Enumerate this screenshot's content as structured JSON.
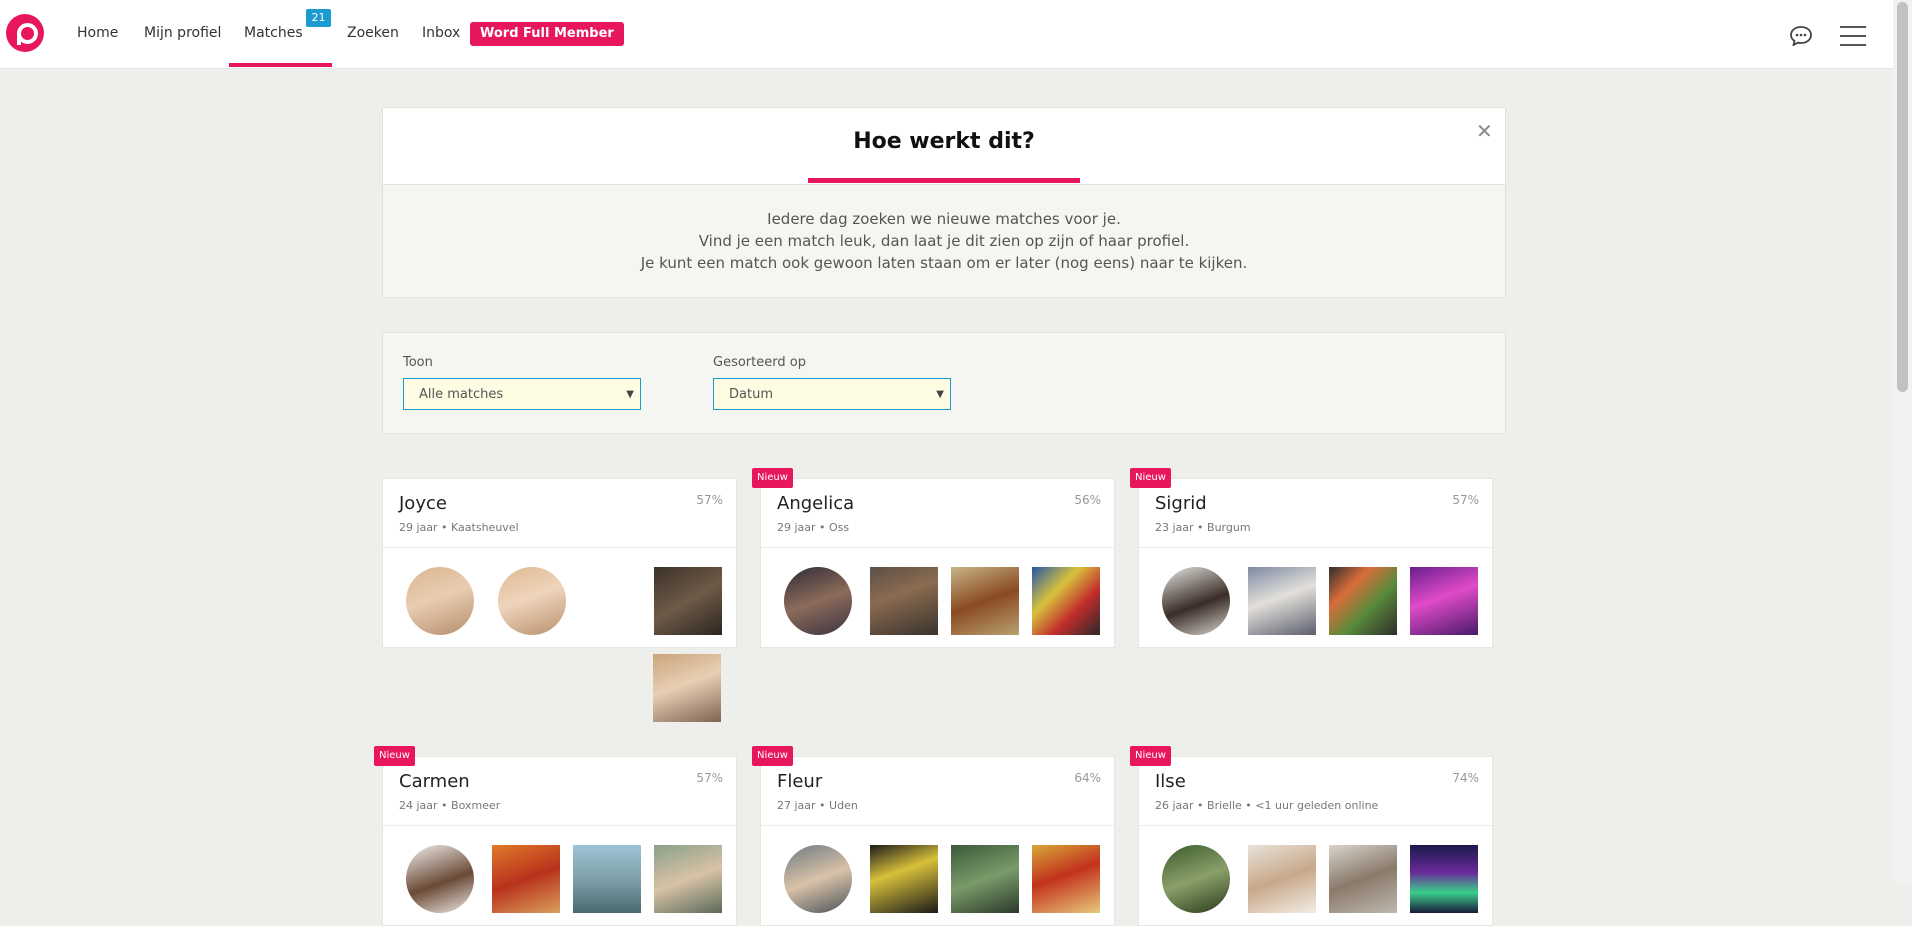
{
  "nav": {
    "items": [
      {
        "label": "Home"
      },
      {
        "label": "Mijn profiel"
      },
      {
        "label": "Matches"
      },
      {
        "label": "Zoeken"
      },
      {
        "label": "Inbox"
      }
    ],
    "matches_badge": "21",
    "cta_label": "Word Full Member",
    "active_item": "Matches"
  },
  "colors": {
    "brand": "#e8175d",
    "badge": "#1b9bd1",
    "select_bg": "#fefde3"
  },
  "icons": {
    "logo": "logo-icon",
    "chat": "chat-icon",
    "menu": "hamburger-icon",
    "close": "close-icon"
  },
  "info": {
    "title": "Hoe werkt dit?",
    "line1": "Iedere dag zoeken we nieuwe matches voor je.",
    "line2": "Vind je een match leuk, dan laat je dit zien op zijn of haar profiel.",
    "line3": "Je kunt een match ook gewoon laten staan om er later (nog eens) naar te kijken."
  },
  "filters": {
    "show_label": "Toon",
    "show_value": "Alle matches",
    "sort_label": "Gesorteerd op",
    "sort_value": "Datum"
  },
  "matches": [
    {
      "name": "Joyce",
      "meta": "29 jaar • Kaatsheuvel",
      "pct": "57%",
      "new": false
    },
    {
      "name": "Angelica",
      "meta": "29 jaar • Oss",
      "pct": "56%",
      "new": true,
      "new_label": "Nieuw"
    },
    {
      "name": "Sigrid",
      "meta": "23 jaar • Burgum",
      "pct": "57%",
      "new": true,
      "new_label": "Nieuw"
    },
    {
      "name": "Carmen",
      "meta": "24 jaar • Boxmeer",
      "pct": "57%",
      "new": true,
      "new_label": "Nieuw"
    },
    {
      "name": "Fleur",
      "meta": "27 jaar • Uden",
      "pct": "64%",
      "new": true,
      "new_label": "Nieuw"
    },
    {
      "name": "Ilse",
      "meta": "26 jaar • Brielle • <1 uur geleden online",
      "pct": "74%",
      "new": true,
      "new_label": "Nieuw"
    }
  ]
}
